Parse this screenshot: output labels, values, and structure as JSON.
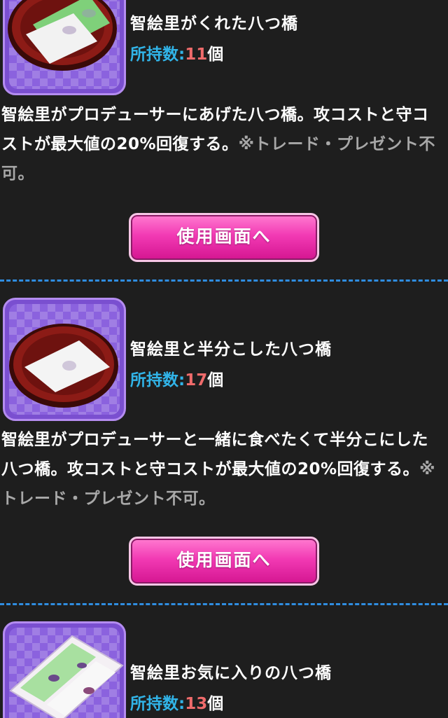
{
  "items": [
    {
      "name": "智絵里がくれた八つ橋",
      "count_label": "所持数:",
      "count_value": "11",
      "count_unit": "個",
      "description": "智絵里がプロデューサーにあげた八つ橋。攻コストと守コストが最大値の20%回復する。",
      "note": "※トレード・プレゼント不可。",
      "button_label": "使用画面へ",
      "image_icon": "green-white-yatsuhashi-on-plate-icon"
    },
    {
      "name": "智絵里と半分こした八つ橋",
      "count_label": "所持数:",
      "count_value": "17",
      "count_unit": "個",
      "description": "智絵里がプロデューサーと一緒に食べたくて半分こにした八つ橋。攻コストと守コストが最大値の20%回復する。",
      "note": "※トレード・プレゼント不可。",
      "button_label": "使用画面へ",
      "image_icon": "white-yatsuhashi-on-plate-icon"
    },
    {
      "name": "智絵里お気に入りの八つ橋",
      "count_label": "所持数:",
      "count_value": "13",
      "count_unit": "個",
      "image_icon": "yatsuhashi-box-icon"
    }
  ],
  "colors": {
    "background": "#1e1e1e",
    "count_label": "#31b4e8",
    "count_value": "#ef6b6b",
    "note": "#a8a8a8",
    "button": "#f23ab4",
    "divider": "#2f8de0",
    "thumb_frame": "#7a4fd0"
  }
}
